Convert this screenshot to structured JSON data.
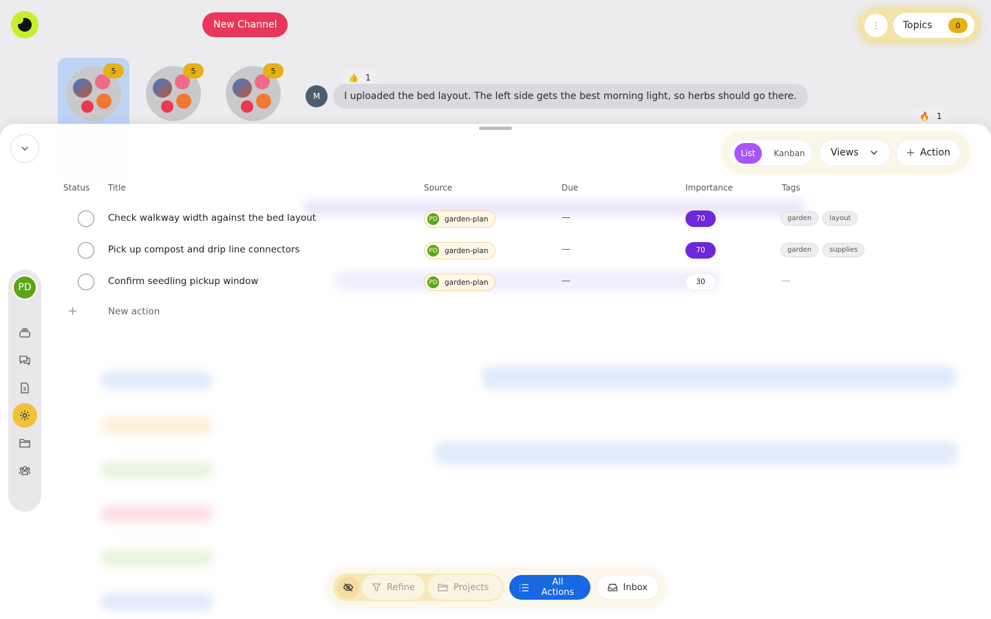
{
  "header": {
    "new_channel_label": "New Channel",
    "topics_label": "Topics",
    "topics_count": "0",
    "kebab_glyph": "⋮"
  },
  "channels": [
    {
      "badge": "5",
      "active": true
    },
    {
      "badge": "5",
      "active": false
    },
    {
      "badge": "5",
      "active": false
    }
  ],
  "message": {
    "avatar_initial": "M",
    "text": "I uploaded the bed layout. The left side gets the best morning light, so herbs should go there.",
    "reaction_top": {
      "emoji": "👍",
      "count": "1"
    },
    "reaction_bottom": {
      "emoji": "🔥",
      "count": "1"
    }
  },
  "rail": {
    "user_initials": "PD",
    "icons": [
      "stack-icon",
      "chat-icon",
      "document-icon",
      "gear-icon",
      "folder-icon",
      "people-icon"
    ],
    "active_icon": "gear-icon"
  },
  "toolbar": {
    "list_label": "List",
    "kanban_label": "Kanban",
    "views_label": "Views",
    "action_label": "Action"
  },
  "table": {
    "headers": {
      "status": "Status",
      "title": "Title",
      "source": "Source",
      "due": "Due",
      "importance": "Importance",
      "tags": "Tags"
    },
    "rows": [
      {
        "title": "Check walkway width against the bed layout",
        "source_initials": "PD",
        "source": "garden-plan",
        "due": "—",
        "importance": "70",
        "tags": [
          "garden",
          "layout"
        ]
      },
      {
        "title": "Pick up compost and drip line connectors",
        "source_initials": "PD",
        "source": "garden-plan",
        "due": "—",
        "importance": "70",
        "tags": [
          "garden",
          "supplies"
        ]
      },
      {
        "title": "Confirm seedling pickup window",
        "source_initials": "PD",
        "source": "garden-plan",
        "due": "—",
        "importance": "30",
        "tags_empty": "—"
      }
    ],
    "new_action_label": "New action"
  },
  "bottom_bar": {
    "refine_label": "Refine",
    "projects_label": "Projects",
    "all_actions_label": "All Actions",
    "inbox_label": "Inbox"
  },
  "colors": {
    "accent_purple": "#a855f7",
    "importance_high": "#6d28d9",
    "primary_blue": "#1668e3",
    "new_channel_red": "#e8375a",
    "badge_gold": "#e5b116",
    "logo_lime": "#c7f028",
    "user_green": "#5aa619"
  }
}
